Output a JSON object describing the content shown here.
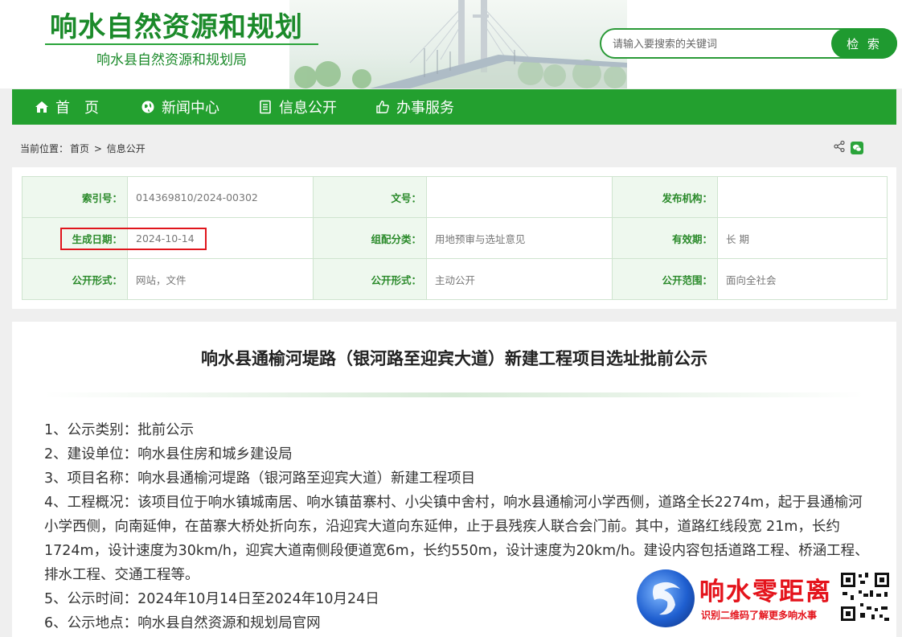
{
  "header": {
    "title": "响水自然资源和规划",
    "subtitle": "响水县自然资源和规划局"
  },
  "search": {
    "placeholder": "请输入要搜索的关键词",
    "button": "检 索"
  },
  "nav": {
    "items": [
      {
        "label": "首　页",
        "icon": "home-icon"
      },
      {
        "label": "新闻中心",
        "icon": "globe-icon"
      },
      {
        "label": "信息公开",
        "icon": "document-icon"
      },
      {
        "label": "办事服务",
        "icon": "thumbs-up-icon"
      }
    ]
  },
  "breadcrumb": {
    "prefix": "当前位置：",
    "home": "首页",
    "sep": ">",
    "current": "信息公开"
  },
  "meta": {
    "rows": [
      [
        {
          "label": "索引号：",
          "value": "014369810/2024-00302"
        },
        {
          "label": "文号：",
          "value": ""
        },
        {
          "label": "发布机构：",
          "value": ""
        }
      ],
      [
        {
          "label": "生成日期：",
          "value": "2024-10-14"
        },
        {
          "label": "组配分类：",
          "value": "用地预审与选址意见"
        },
        {
          "label": "有效期：",
          "value": "长 期"
        }
      ],
      [
        {
          "label": "公开形式：",
          "value": "网站，文件"
        },
        {
          "label": "公开形式：",
          "value": "主动公开"
        },
        {
          "label": "公开范围：",
          "value": "面向全社会"
        }
      ]
    ],
    "highlight_color": "#e0151c"
  },
  "article": {
    "title": "响水县通榆河堤路（银河路至迎宾大道）新建工程项目选址批前公示",
    "paragraphs": [
      "1、公示类别：批前公示",
      "2、建设单位：响水县住房和城乡建设局",
      "3、项目名称：响水县通榆河堤路（银河路至迎宾大道）新建工程项目",
      "4、工程概况：该项目位于响水镇城南居、响水镇苗寨村、小尖镇中舍村，响水县通榆河小学西侧，道路全长2274m，起于县通榆河小学西侧，向南延伸，在苗寨大桥处折向东，沿迎宾大道向东延伸，止于县残疾人联合会门前。其中，道路红线段宽 21m，长约1724m，设计速度为30km/h，迎宾大道南侧段便道宽6m，长约550m，设计速度为20km/h。建设内容包括道路工程、桥涵工程、排水工程、交通工程等。",
      "5、公示时间：2024年10月14日至2024年10月24日",
      "6、公示地点：响水县自然资源和规划局官网"
    ]
  },
  "watermark": {
    "title": "响水零距离",
    "subtitle": "识别二维码了解更多响水事"
  },
  "colors": {
    "brand_green": "#23a02f",
    "title_green": "#1b8a2a",
    "label_green": "#2a8a2a",
    "watermark_red": "#e4131b"
  }
}
